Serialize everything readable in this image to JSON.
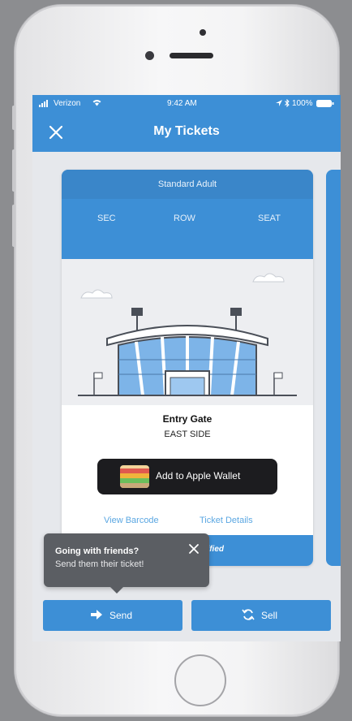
{
  "status_bar": {
    "carrier": "Verizon",
    "time": "9:42 AM",
    "battery": "100%"
  },
  "nav": {
    "title": "My Tickets"
  },
  "ticket": {
    "type": "Standard Adult",
    "labels": {
      "section": "SEC",
      "row": "ROW",
      "seat": "SEAT"
    },
    "gate_title": "Entry Gate",
    "gate_value": "EAST SIDE",
    "wallet_button": "Add to Apple Wallet",
    "view_barcode": "View Barcode",
    "ticket_details": "Ticket Details",
    "verified_partial": "erified"
  },
  "tooltip": {
    "title": "Going with friends?",
    "body": "Send them their ticket!"
  },
  "actions": {
    "send": "Send",
    "sell": "Sell"
  },
  "colors": {
    "brand_blue": "#3d8fd6",
    "tooltip_bg": "#5b5e63",
    "link_blue": "#5ba7e2"
  },
  "icons": {
    "close": "close-icon",
    "send": "arrow-right-icon",
    "sell": "refresh-icon"
  }
}
